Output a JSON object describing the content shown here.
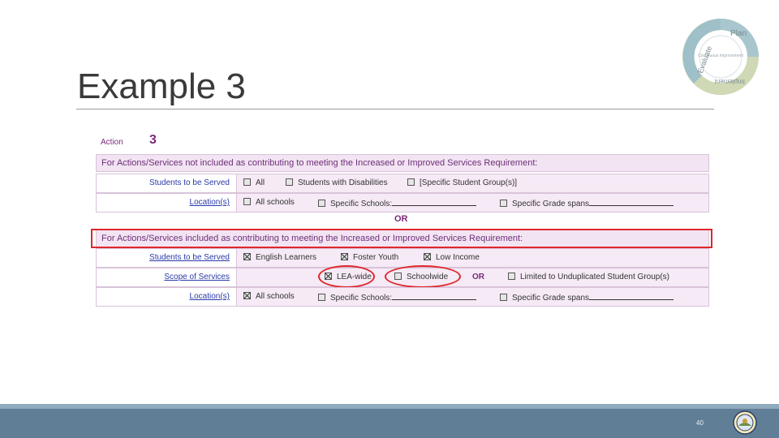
{
  "slide": {
    "title": "Example 3",
    "page_number": "40"
  },
  "logo": {
    "icon": "continuous-improvement-cycle-icon",
    "segments": [
      "Plan",
      "Implement",
      "Evaluate"
    ],
    "center_text": "Continuous Improvement"
  },
  "form": {
    "action_label": "Action",
    "action_number": "3",
    "section1": {
      "header": "For Actions/Services not included as contributing to meeting the Increased or Improved Services Requirement:",
      "students_label": "Students to be Served",
      "students_options": [
        {
          "label": "All",
          "checked": false
        },
        {
          "label": "Students with Disabilities",
          "checked": false
        },
        {
          "label": "[Specific Student Group(s)]",
          "checked": false
        }
      ],
      "location_label": "Location(s)",
      "location_options": [
        {
          "label": "All schools",
          "checked": false
        },
        {
          "label": "Specific Schools:",
          "checked": false
        },
        {
          "label": "Specific Grade spans",
          "checked": false
        }
      ]
    },
    "or_text": "OR",
    "section2": {
      "header": "For Actions/Services included as contributing to meeting the Increased or Improved Services Requirement:",
      "students_label": "Students to be Served",
      "students_options": [
        {
          "label": "English Learners",
          "checked": true
        },
        {
          "label": "Foster Youth",
          "checked": true
        },
        {
          "label": "Low Income",
          "checked": true
        }
      ],
      "scope_label": "Scope of Services",
      "scope_options": [
        {
          "label": "LEA-wide",
          "checked": true
        },
        {
          "label": "Schoolwide",
          "checked": false
        },
        {
          "label": "Limited to Unduplicated Student Group(s)",
          "checked": false
        }
      ],
      "scope_or": "OR",
      "location_label": "Location(s)",
      "location_options": [
        {
          "label": "All schools",
          "checked": true
        },
        {
          "label": "Specific Schools:",
          "checked": false
        },
        {
          "label": "Specific Grade spans",
          "checked": false
        }
      ]
    }
  },
  "colors": {
    "accent_purple": "#7a2a7a",
    "highlight_red": "#e0262b",
    "footer": "#607f96"
  }
}
